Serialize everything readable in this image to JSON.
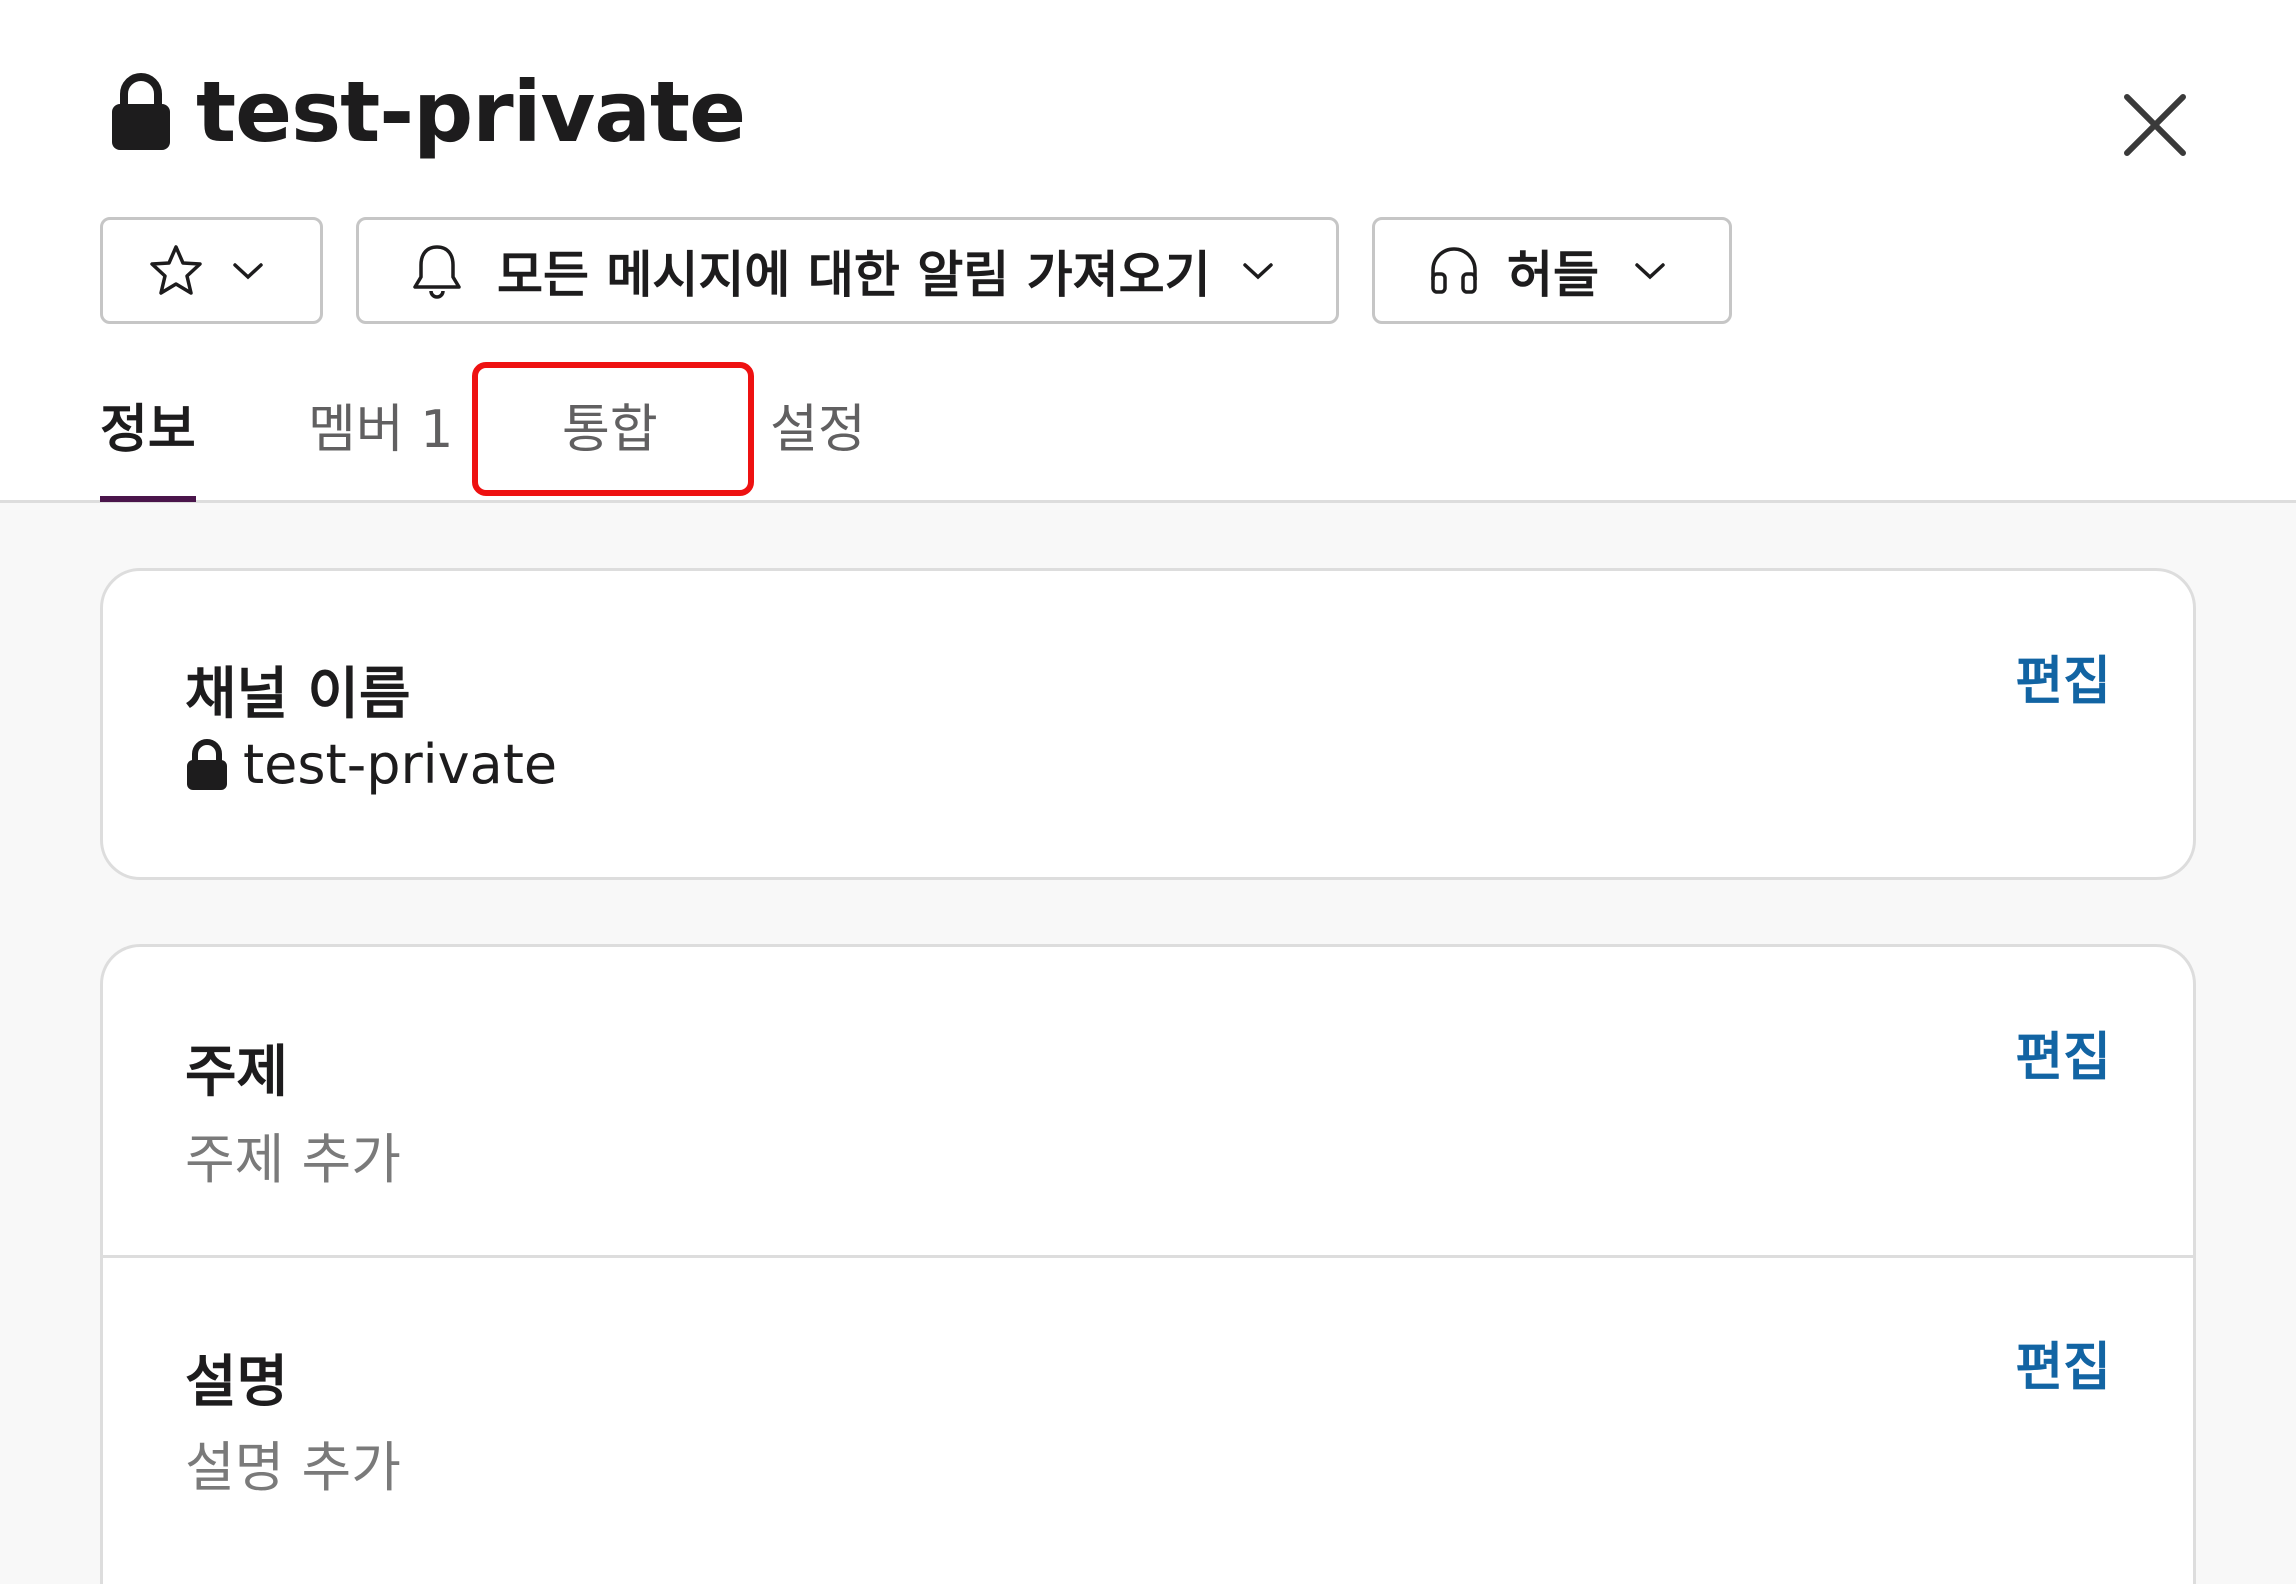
{
  "channel": {
    "title": "test-private",
    "privacy_icon": "lock-icon"
  },
  "toolbar": {
    "star_icon": "star-outline-icon",
    "notify_label": "모든 메시지에 대한 알림 가져오기",
    "notify_icon": "bell-icon",
    "huddle_label": "허들",
    "huddle_icon": "headphones-icon"
  },
  "tabs": [
    {
      "label": "정보",
      "active": true
    },
    {
      "label": "멤버 1",
      "active": false
    },
    {
      "label": "통합",
      "active": false,
      "highlighted": true
    },
    {
      "label": "설정",
      "active": false
    }
  ],
  "sections": {
    "name": {
      "label": "채널 이름",
      "value": "test-private",
      "edit_label": "편집"
    },
    "topic": {
      "label": "주제",
      "value": "주제 추가",
      "edit_label": "편집"
    },
    "description": {
      "label": "설명",
      "value": "설명 추가",
      "edit_label": "편집"
    }
  },
  "colors": {
    "accent_tab_underline": "#4a154b",
    "link": "#1264a3",
    "highlight": "#ee1111"
  }
}
